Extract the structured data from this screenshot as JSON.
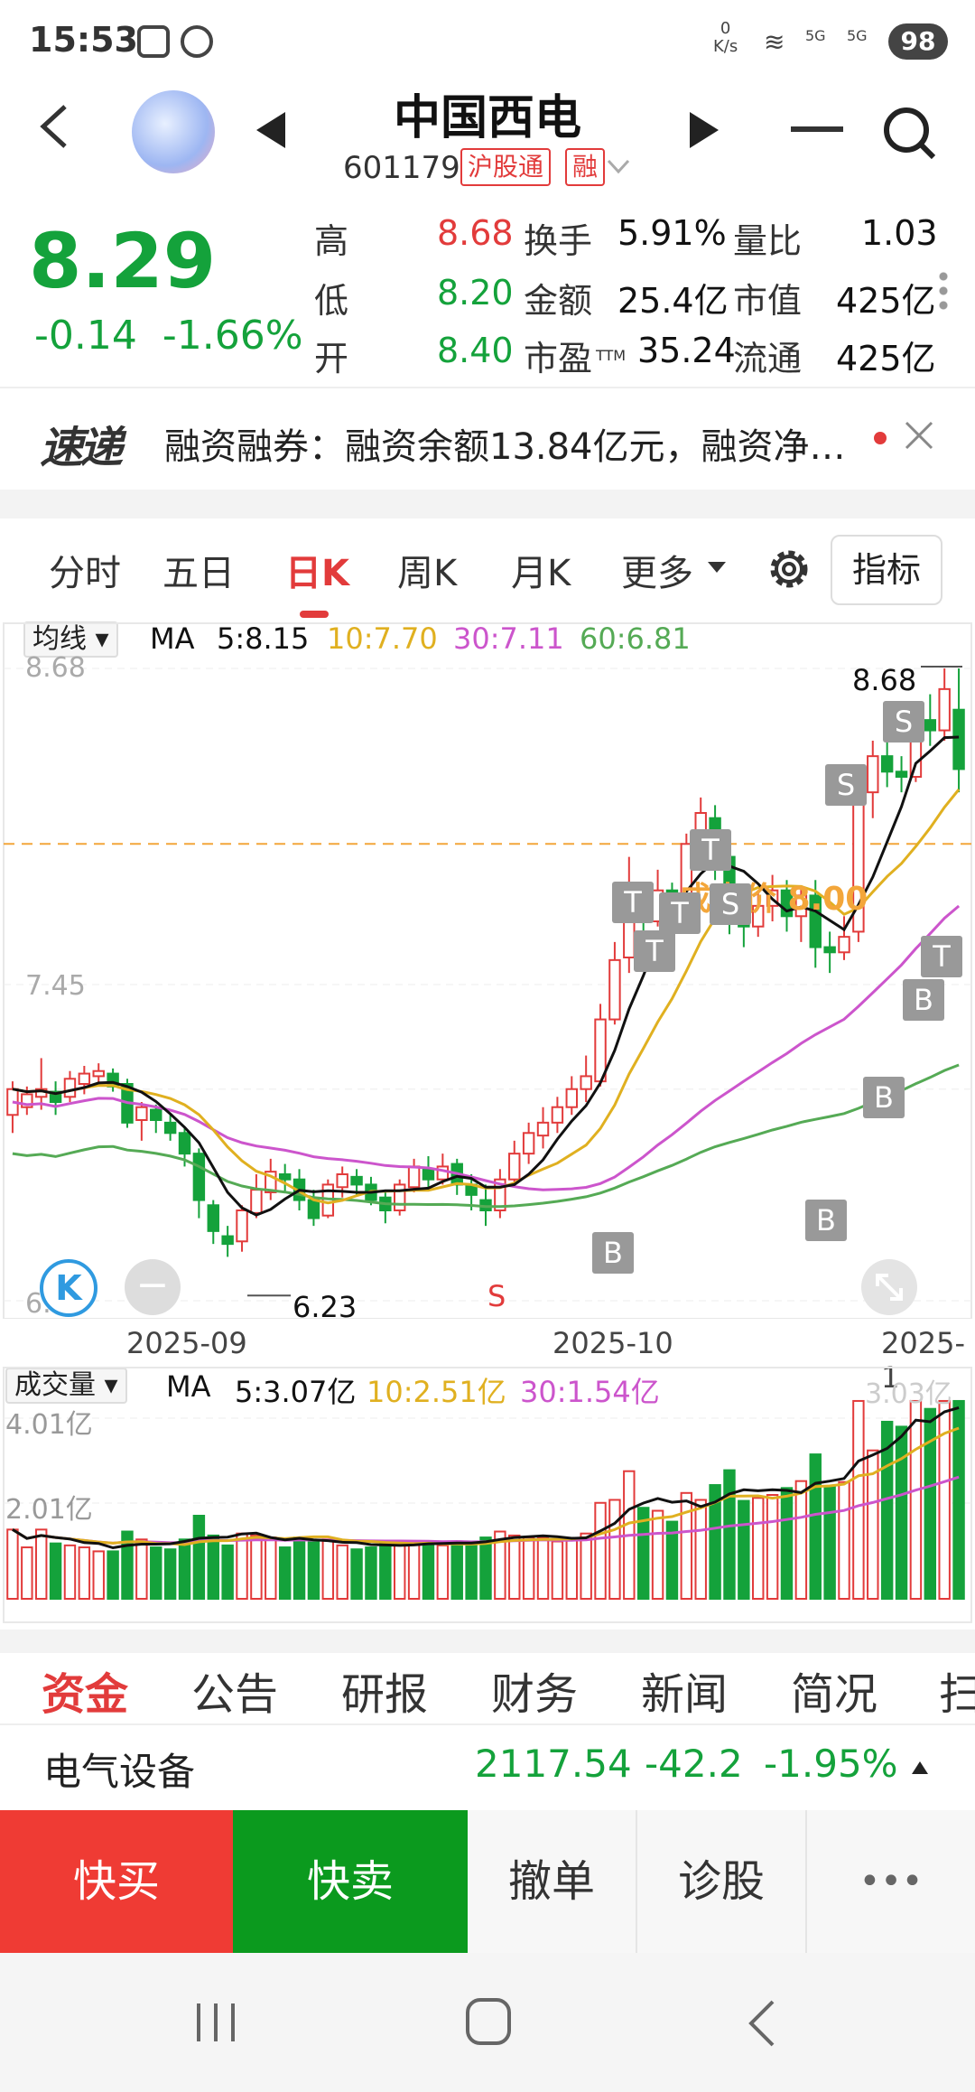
{
  "status_bar": {
    "time": "15:53",
    "net_speed_value": "0",
    "net_speed_unit": "K/s",
    "signal1": "5G",
    "signal2": "5G",
    "battery": "98"
  },
  "header": {
    "stock_name": "中国西电",
    "stock_code": "601179",
    "tag_connect": "沪股通",
    "tag_margin": "融"
  },
  "quote": {
    "price": "8.29",
    "change": "-0.14",
    "change_pct": "-1.66%",
    "high_label": "高",
    "high": "8.68",
    "low_label": "低",
    "low": "8.20",
    "open_label": "开",
    "open": "8.40",
    "turnover_label": "换手",
    "turnover": "5.91%",
    "amount_label": "金额",
    "amount": "25.4亿",
    "pe_label": "市盈",
    "pe_sub": "TTM",
    "pe": "35.24",
    "vol_ratio_label": "量比",
    "vol_ratio": "1.03",
    "mcap_label": "市值",
    "mcap": "425亿",
    "float_label": "流通",
    "float_cap": "425亿"
  },
  "news_ticker": {
    "logo": "速递",
    "text": "融资融券：融资余额13.84亿元，融资净…"
  },
  "period_tabs": [
    "分时",
    "五日",
    "日K",
    "周K",
    "月K",
    "更多"
  ],
  "active_period": "日K",
  "indicator_button": "指标",
  "price_legend": {
    "selector": "均线",
    "ma": "MA",
    "ma5": "5:8.15",
    "ma10": "10:7.70",
    "ma30": "30:7.11",
    "ma60": "60:6.81"
  },
  "volume_legend": {
    "selector": "成交量",
    "ma": "MA",
    "ma5": "5:3.07亿",
    "ma10": "10:2.51亿",
    "ma30": "30:1.54亿"
  },
  "chart_labels": {
    "y_top": "8.68",
    "y_mid": "7.45",
    "y_bottom": "6.23",
    "max_mark": "8.68",
    "min_mark": "6.23",
    "cost_price": "成本价 8.00",
    "vol_top": "4.01亿",
    "vol_mid": "2.01亿",
    "vol_last": "3.03亿",
    "date1": "2025-09",
    "date2": "2025-10",
    "date3": "2025-1"
  },
  "signal_markers": [
    "T",
    "T",
    "T",
    "T",
    "S",
    "S",
    "S",
    "B",
    "B",
    "B",
    "B",
    "T",
    "B",
    "S"
  ],
  "colors": {
    "up": "#e23b3b",
    "down": "#14a23b",
    "ma5": "#111111",
    "ma10": "#e0b020",
    "ma30": "#cc55cc",
    "ma60": "#55aa55",
    "cost_line": "#f3a63a"
  },
  "chart_data": {
    "type": "candlestick",
    "ylim": [
      6.23,
      8.68
    ],
    "candles": [
      [
        6.95,
        7.05,
        6.88,
        7.08
      ],
      [
        6.98,
        7.03,
        6.95,
        7.06
      ],
      [
        7.02,
        7.05,
        6.97,
        7.17
      ],
      [
        7.04,
        7.0,
        6.95,
        7.08
      ],
      [
        7.02,
        7.09,
        7.0,
        7.12
      ],
      [
        7.07,
        7.11,
        7.03,
        7.14
      ],
      [
        7.1,
        7.12,
        7.06,
        7.15
      ],
      [
        7.11,
        7.06,
        7.04,
        7.13
      ],
      [
        7.07,
        6.92,
        6.9,
        7.09
      ],
      [
        6.93,
        6.98,
        6.85,
        7.0
      ],
      [
        6.97,
        6.93,
        6.88,
        6.99
      ],
      [
        6.92,
        6.88,
        6.85,
        6.95
      ],
      [
        6.88,
        6.8,
        6.75,
        6.9
      ],
      [
        6.8,
        6.62,
        6.55,
        6.82
      ],
      [
        6.6,
        6.5,
        6.45,
        6.62
      ],
      [
        6.48,
        6.45,
        6.4,
        6.52
      ],
      [
        6.46,
        6.58,
        6.42,
        6.6
      ],
      [
        6.57,
        6.66,
        6.55,
        6.72
      ],
      [
        6.65,
        6.73,
        6.62,
        6.78
      ],
      [
        6.72,
        6.7,
        6.65,
        6.76
      ],
      [
        6.7,
        6.62,
        6.58,
        6.74
      ],
      [
        6.62,
        6.55,
        6.52,
        6.66
      ],
      [
        6.56,
        6.68,
        6.55,
        6.7
      ],
      [
        6.67,
        6.72,
        6.63,
        6.75
      ],
      [
        6.71,
        6.68,
        6.64,
        6.74
      ],
      [
        6.68,
        6.62,
        6.6,
        6.71
      ],
      [
        6.63,
        6.58,
        6.53,
        6.66
      ],
      [
        6.58,
        6.68,
        6.56,
        6.7
      ],
      [
        6.67,
        6.75,
        6.65,
        6.78
      ],
      [
        6.74,
        6.7,
        6.66,
        6.79
      ],
      [
        6.7,
        6.75,
        6.68,
        6.8
      ],
      [
        6.76,
        6.68,
        6.64,
        6.78
      ],
      [
        6.68,
        6.64,
        6.58,
        6.72
      ],
      [
        6.62,
        6.58,
        6.52,
        6.68
      ],
      [
        6.58,
        6.7,
        6.55,
        6.74
      ],
      [
        6.7,
        6.8,
        6.68,
        6.85
      ],
      [
        6.8,
        6.88,
        6.76,
        6.92
      ],
      [
        6.87,
        6.92,
        6.82,
        6.98
      ],
      [
        6.92,
        6.98,
        6.88,
        7.02
      ],
      [
        6.98,
        7.05,
        6.95,
        7.1
      ],
      [
        7.05,
        7.1,
        7.0,
        7.18
      ],
      [
        7.08,
        7.32,
        7.06,
        7.38
      ],
      [
        7.32,
        7.55,
        7.3,
        7.62
      ],
      [
        7.56,
        7.78,
        7.5,
        7.95
      ],
      [
        7.78,
        7.7,
        7.6,
        7.85
      ],
      [
        7.7,
        7.82,
        7.68,
        7.9
      ],
      [
        7.82,
        7.78,
        7.7,
        7.85
      ],
      [
        7.8,
        8.0,
        7.76,
        8.04
      ],
      [
        8.0,
        8.12,
        7.95,
        8.18
      ],
      [
        8.1,
        7.95,
        7.86,
        8.15
      ],
      [
        7.95,
        7.72,
        7.65,
        8.0
      ],
      [
        7.72,
        7.68,
        7.6,
        7.78
      ],
      [
        7.68,
        7.76,
        7.64,
        7.82
      ],
      [
        7.76,
        7.82,
        7.7,
        7.88
      ],
      [
        7.82,
        7.72,
        7.66,
        7.86
      ],
      [
        7.72,
        7.8,
        7.62,
        7.84
      ],
      [
        7.8,
        7.6,
        7.52,
        7.86
      ],
      [
        7.6,
        7.58,
        7.5,
        7.66
      ],
      [
        7.58,
        7.64,
        7.55,
        7.72
      ],
      [
        7.66,
        8.2,
        7.62,
        8.28
      ],
      [
        8.2,
        8.34,
        8.1,
        8.4
      ],
      [
        8.34,
        8.28,
        8.22,
        8.4
      ],
      [
        8.28,
        8.26,
        8.2,
        8.34
      ],
      [
        8.26,
        8.48,
        8.24,
        8.55
      ],
      [
        8.48,
        8.44,
        8.38,
        8.58
      ],
      [
        8.44,
        8.6,
        8.4,
        8.68
      ],
      [
        8.52,
        8.29,
        8.2,
        8.68
      ]
    ],
    "volume_units": "亿"
  },
  "bottom_tabs": [
    "资金",
    "公告",
    "研报",
    "财务",
    "新闻",
    "简况",
    "扫"
  ],
  "active_bottom_tab": "资金",
  "sector": {
    "name": "电气设备",
    "value": "2117.54",
    "change": "-42.2",
    "change_pct": "-1.95%"
  },
  "actions": {
    "buy": "快买",
    "sell": "快卖",
    "cancel": "撤单",
    "diagnose": "诊股",
    "more": "•••"
  }
}
